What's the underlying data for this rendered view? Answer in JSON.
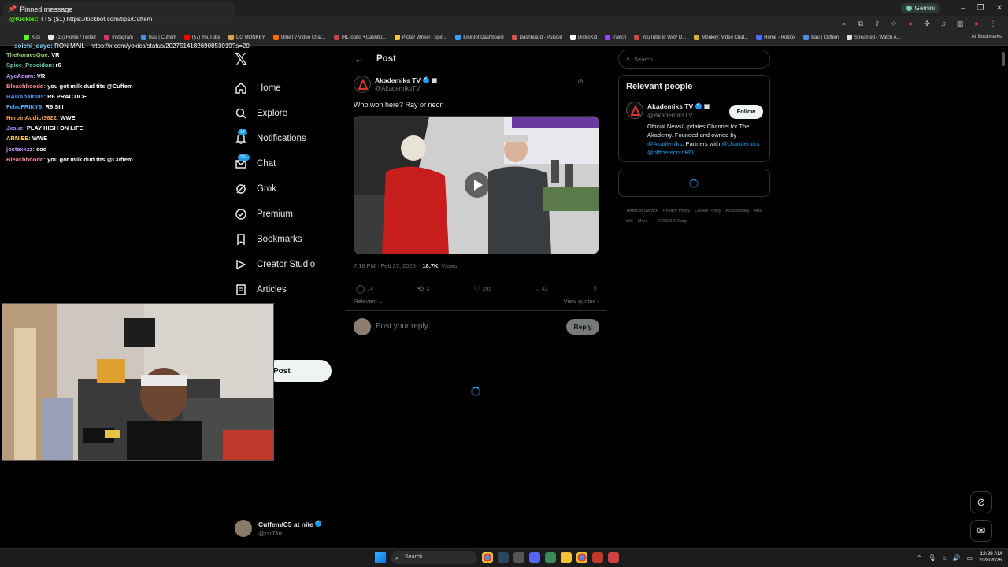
{
  "browser": {
    "gemini_label": "Gemini",
    "bookmarks": [
      "Kick",
      "(15) Home / Twitter",
      "Instagram",
      "Bau | Cuffem",
      "(57) YouTube",
      "OG MONKEY",
      "OmeTV Video Chat...",
      "IRLToolkit • Dashbo...",
      "Picker Wheel - Spin...",
      "KickBot Dashboard",
      "Dashboard - Pulsoid",
      "DistroKid",
      "Twitch",
      "YouTube to WAV D...",
      "Monkey: Video Chat...",
      "Home - Roblox",
      "Bau | Cuffem",
      "Streamed - Watch A..."
    ],
    "all_bookmarks": "All Bookmarks",
    "bookmark_colors": [
      "#53fc18",
      "#e7e9ea",
      "#e1306c",
      "#4a90e2",
      "#ff0000",
      "#d7a24a",
      "#ff6a00",
      "#d04040",
      "#f5c542",
      "#3aa0ff",
      "#e05050",
      "#ffffff",
      "#9146ff",
      "#e04040",
      "#e0b030",
      "#4a6cff",
      "#4a90e2",
      "#e0e0e0"
    ]
  },
  "chat_overlay": {
    "pinned_title": "Pinned message",
    "pinned_user": "@Kicklet:",
    "pinned_text": "TTS ($1) https://kickbot.com/tips/Cuffem",
    "top_user": "soichi_dayo:",
    "top_text": "RON MAIL - https://x.com/yoxics/status/2027514182690853019?s=20",
    "messages": [
      {
        "user": "TheNamesQue:",
        "text": "VR",
        "color": "#9ed36a"
      },
      {
        "user": "Spice_Poseidon:",
        "text": "r6",
        "color": "#6ad3b4"
      },
      {
        "user": "AyeAdam:",
        "text": "VR",
        "color": "#c49bff"
      },
      {
        "user": "Bleachhoodd:",
        "text": "you got milk dud tits @Cuffem",
        "color": "#ff8fa3"
      },
      {
        "user": "BAUAbaits05:",
        "text": "R6 PRACTICE",
        "color": "#4f9dff"
      },
      {
        "user": "FelruFRIKY6:",
        "text": "R6 SIII",
        "color": "#4fb3ff"
      },
      {
        "user": "HeroinAddict3622:",
        "text": "WWE",
        "color": "#ffa64d"
      },
      {
        "user": "Jxsue:",
        "text": "PLAY HIGH ON LIFE",
        "color": "#b18cff"
      },
      {
        "user": "ARNIEE:",
        "text": "WWE",
        "color": "#ffd24d"
      },
      {
        "user": "jostaxkzz:",
        "text": "cod",
        "color": "#c49bff"
      },
      {
        "user": "Bleachhoodd:",
        "text": "you got milk dud tits @Cuffem",
        "color": "#ff8fa3"
      }
    ]
  },
  "nav": {
    "items": [
      {
        "label": "Home",
        "icon": "home-icon"
      },
      {
        "label": "Explore",
        "icon": "search-icon"
      },
      {
        "label": "Notifications",
        "icon": "bell-icon",
        "badge": "17"
      },
      {
        "label": "Chat",
        "icon": "mail-icon",
        "badge": "20+"
      },
      {
        "label": "Grok",
        "icon": "grok-icon"
      },
      {
        "label": "Premium",
        "icon": "premium-icon"
      },
      {
        "label": "Bookmarks",
        "icon": "bookmark-icon"
      },
      {
        "label": "Creator Studio",
        "icon": "creator-studio-icon"
      },
      {
        "label": "Articles",
        "icon": "articles-icon"
      }
    ],
    "post_button": "Post",
    "account_name": "Cuffem/C5 at nite",
    "account_handle": "@cuff3m"
  },
  "post": {
    "header": "Post",
    "author_name": "Akademiks TV",
    "author_handle": "@AkademiksTV",
    "text": "Who won here? Ray or neon",
    "time": "7:16 PM · Feb 27, 2026 ·",
    "views_count": "18.7K",
    "views_label": "Views",
    "replies": "74",
    "reposts": "3",
    "likes": "205",
    "bookmarks": "41",
    "sort_label": "Relevant",
    "view_quotes": "View quotes",
    "reply_placeholder": "Post your reply",
    "reply_button": "Reply"
  },
  "sidebar": {
    "search_placeholder": "Search",
    "relevant_title": "Relevant people",
    "person_name": "Akademiks TV",
    "person_handle": "@AkademiksTV",
    "follow_label": "Follow",
    "bio_text": "Official News/Updates Channel for The Akademy. Founded and owned by",
    "bio_link1": "@Akademiks",
    "bio_mid": ". Partners with",
    "bio_link2": "@chartdemiks",
    "bio_link3": "@offtherecordHD",
    "footer_links": [
      "Terms of Service",
      "Privacy Policy",
      "Cookie Policy",
      "Accessibility",
      "Ads info",
      "More ···",
      "© 2026 X Corp."
    ]
  },
  "taskbar": {
    "search_label": "Search",
    "time": "12:39 AM",
    "date": "2/28/2026"
  }
}
